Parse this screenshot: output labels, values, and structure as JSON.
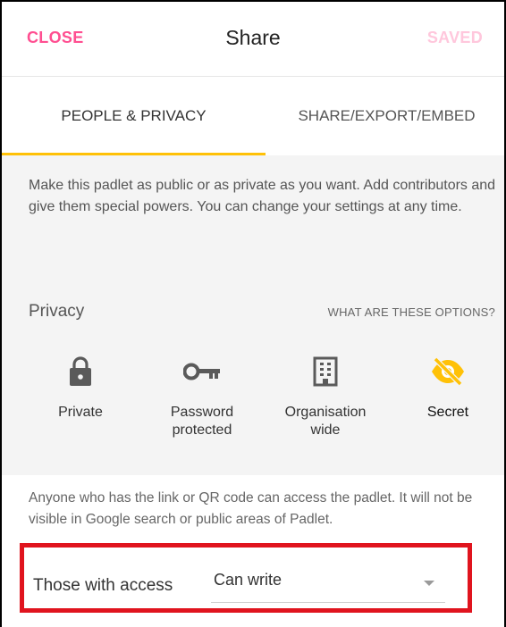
{
  "header": {
    "close_label": "CLOSE",
    "title": "Share",
    "saved_label": "SAVED"
  },
  "tabs": [
    {
      "label": "PEOPLE & PRIVACY",
      "active": true
    },
    {
      "label": "SHARE/EXPORT/EMBED",
      "active": false
    }
  ],
  "description": "Make this padlet as public or as private as you want. Add contributors and give them special powers. You can change your settings at any time.",
  "privacy": {
    "label": "Privacy",
    "help_link": "WHAT ARE THESE OPTIONS?",
    "options": [
      {
        "label": "Private",
        "icon": "lock-icon",
        "selected": false
      },
      {
        "label": "Password protected",
        "icon": "key-icon",
        "selected": false
      },
      {
        "label": "Organisation wide",
        "icon": "building-icon",
        "selected": false
      },
      {
        "label": "Secret",
        "icon": "eye-off-icon",
        "selected": true
      }
    ],
    "info": "Anyone who has the link or QR code can access the padlet. It will not be visible in Google search or public areas of Padlet."
  },
  "access": {
    "label": "Those with access",
    "value": "Can write"
  },
  "colors": {
    "accent_pink": "#ff4f91",
    "saved_pink": "#ffc7dc",
    "tab_underline": "#ffc107",
    "secret_yellow": "#ffc107",
    "highlight_red": "#e0141e",
    "icon_gray": "#5a5a5a"
  }
}
